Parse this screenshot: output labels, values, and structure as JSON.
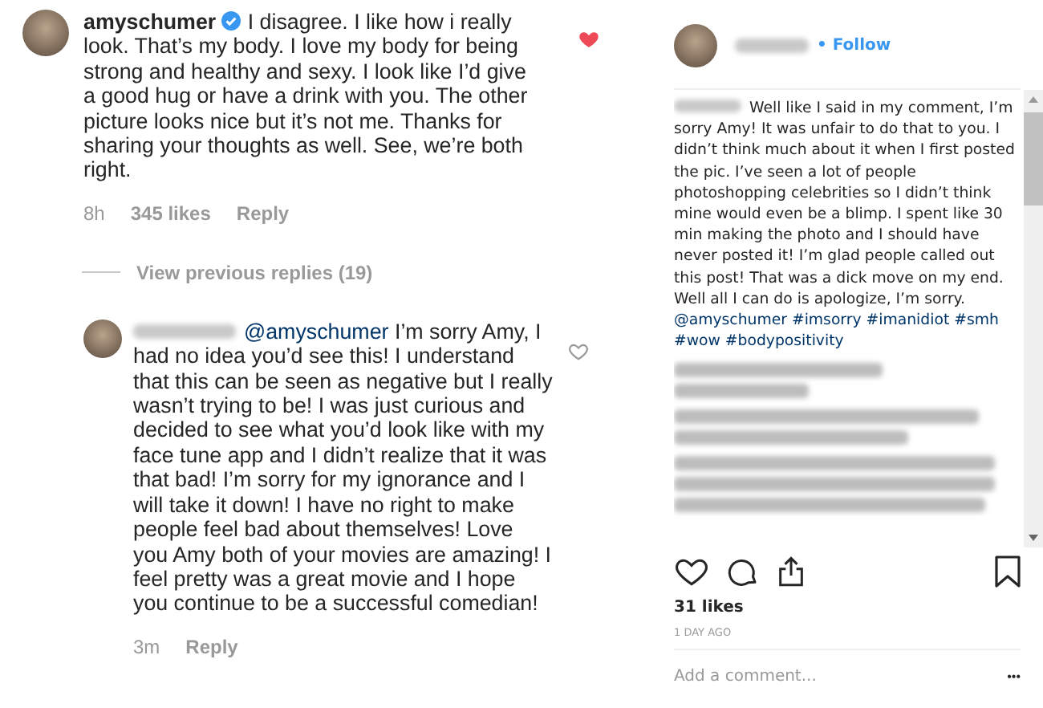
{
  "comment": {
    "username": "amyschumer",
    "verified": true,
    "text": "I disagree. I like how i really look. That’s my body. I love my body for being strong and healthy and sexy. I look like I’d give a good hug or have a drink with you. The other picture looks nice but it’s not me. Thanks for sharing your thoughts as well. See, we’re both right.",
    "time": "8h",
    "likes": "345 likes",
    "reply": "Reply",
    "liked": true
  },
  "view_replies": "View previous replies (19)",
  "reply_comment": {
    "mention": "@amyschumer",
    "text": "I’m sorry Amy, I had no idea you’d see this! I understand that this can be seen as negative but I really wasn’t trying to be! I was just curious and decided to see what you’d look like with my face tune app and I didn’t realize that it was that bad! I’m sorry for my ignorance and I will take it down! I have no right to make people feel bad about themselves! Love you Amy both of your movies are amazing! I feel pretty was a great movie and I hope you continue to be a successful comedian!",
    "time": "3m",
    "reply": "Reply",
    "liked": false
  },
  "post": {
    "follow": "• Follow",
    "caption": "Well like I said in my comment, I’m sorry Amy! It was unfair to do that to you. I didn’t think much about it when I first posted the pic. I’ve seen a lot of people photoshopping celebrities so I didn’t think mine would even be a blimp. I spent like 30 min making the photo and I should have never posted it! I’m glad people called out this post! That was a dick move on my end. Well all I can do is apologize, I’m sorry.",
    "caption_tags": [
      "@amyschumer",
      "#imsorry",
      "#imanidiot",
      "#smh",
      "#wow",
      "#bodypositivity"
    ],
    "likes": "31 likes",
    "age": "1 DAY AGO",
    "add_comment_placeholder": "Add a comment...",
    "more": "•••"
  }
}
